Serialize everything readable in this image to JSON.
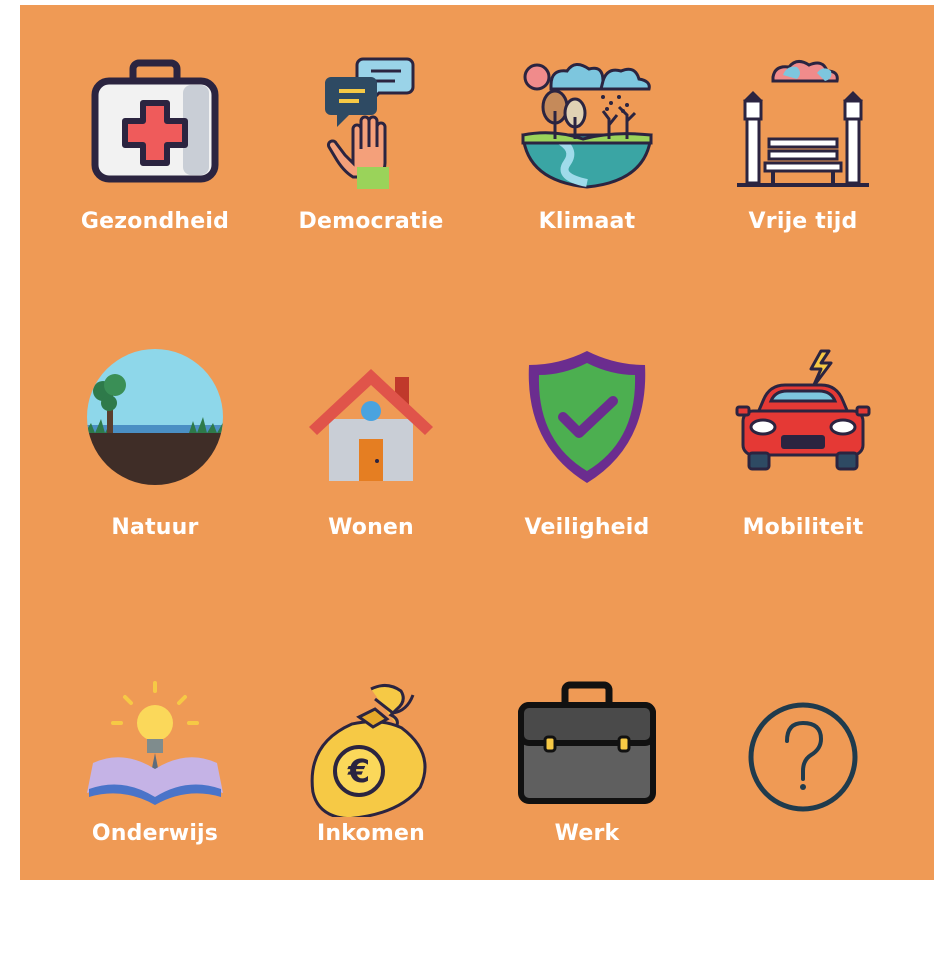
{
  "colors": {
    "background": "#EF9A55",
    "label": "#ffffff"
  },
  "categories": [
    {
      "label": "Gezondheid",
      "icon": "first-aid-kit-icon"
    },
    {
      "label": "Democratie",
      "icon": "speech-bubbles-raised-hand-icon"
    },
    {
      "label": "Klimaat",
      "icon": "climate-landscape-icon"
    },
    {
      "label": "Vrije tijd",
      "icon": "park-bench-icon"
    },
    {
      "label": "Natuur",
      "icon": "nature-landscape-icon"
    },
    {
      "label": "Wonen",
      "icon": "house-icon"
    },
    {
      "label": "Veiligheid",
      "icon": "shield-check-icon"
    },
    {
      "label": "Mobiliteit",
      "icon": "electric-car-icon"
    },
    {
      "label": "Onderwijs",
      "icon": "book-lightbulb-icon"
    },
    {
      "label": "Inkomen",
      "icon": "euro-money-bag-icon"
    },
    {
      "label": "Werk",
      "icon": "briefcase-icon"
    },
    {
      "label": "",
      "icon": "question-mark-icon"
    }
  ]
}
